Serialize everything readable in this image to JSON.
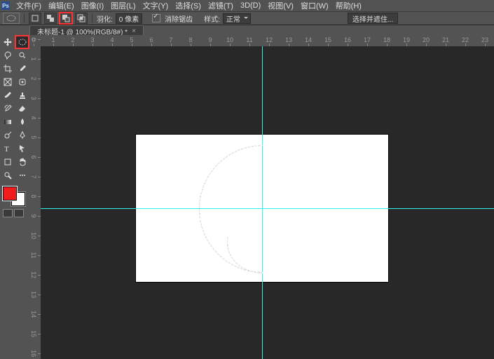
{
  "menu": {
    "items": [
      "文件(F)",
      "编辑(E)",
      "图像(I)",
      "图层(L)",
      "文字(Y)",
      "选择(S)",
      "滤镜(T)",
      "3D(D)",
      "视图(V)",
      "窗口(W)",
      "帮助(H)"
    ]
  },
  "options": {
    "feather_label": "羽化:",
    "feather_value": "0 像素",
    "antialias_label": "消除锯齿",
    "style_label": "样式:",
    "style_value": "正常",
    "select_mask_btn": "选择并遮住..."
  },
  "tab": {
    "title": "未标题-1 @ 100%(RGB/8#) *",
    "close": "×"
  },
  "ruler_h": [
    "0",
    "1",
    "2",
    "3",
    "4",
    "5",
    "6",
    "7",
    "8",
    "9",
    "10",
    "11",
    "12",
    "13",
    "14",
    "15",
    "16",
    "17",
    "18",
    "19",
    "20",
    "21",
    "22",
    "23"
  ],
  "ruler_v": [
    "0",
    "1",
    "2",
    "3",
    "4",
    "5",
    "6",
    "7",
    "8",
    "9",
    "10",
    "11",
    "12",
    "13",
    "14",
    "15",
    "16"
  ],
  "colors": {
    "fg": "#f21c1c",
    "bg": "#ffffff",
    "guide": "#2cf0f0"
  },
  "tool_names": [
    "move",
    "ellipse-select",
    "lasso",
    "magic-wand",
    "crop",
    "eyedropper",
    "frame",
    "spot-heal",
    "brush",
    "stamp",
    "history-brush",
    "eraser",
    "gradient",
    "blur",
    "dodge",
    "pen",
    "type",
    "path-select",
    "rectangle",
    "hand",
    "zoom"
  ]
}
